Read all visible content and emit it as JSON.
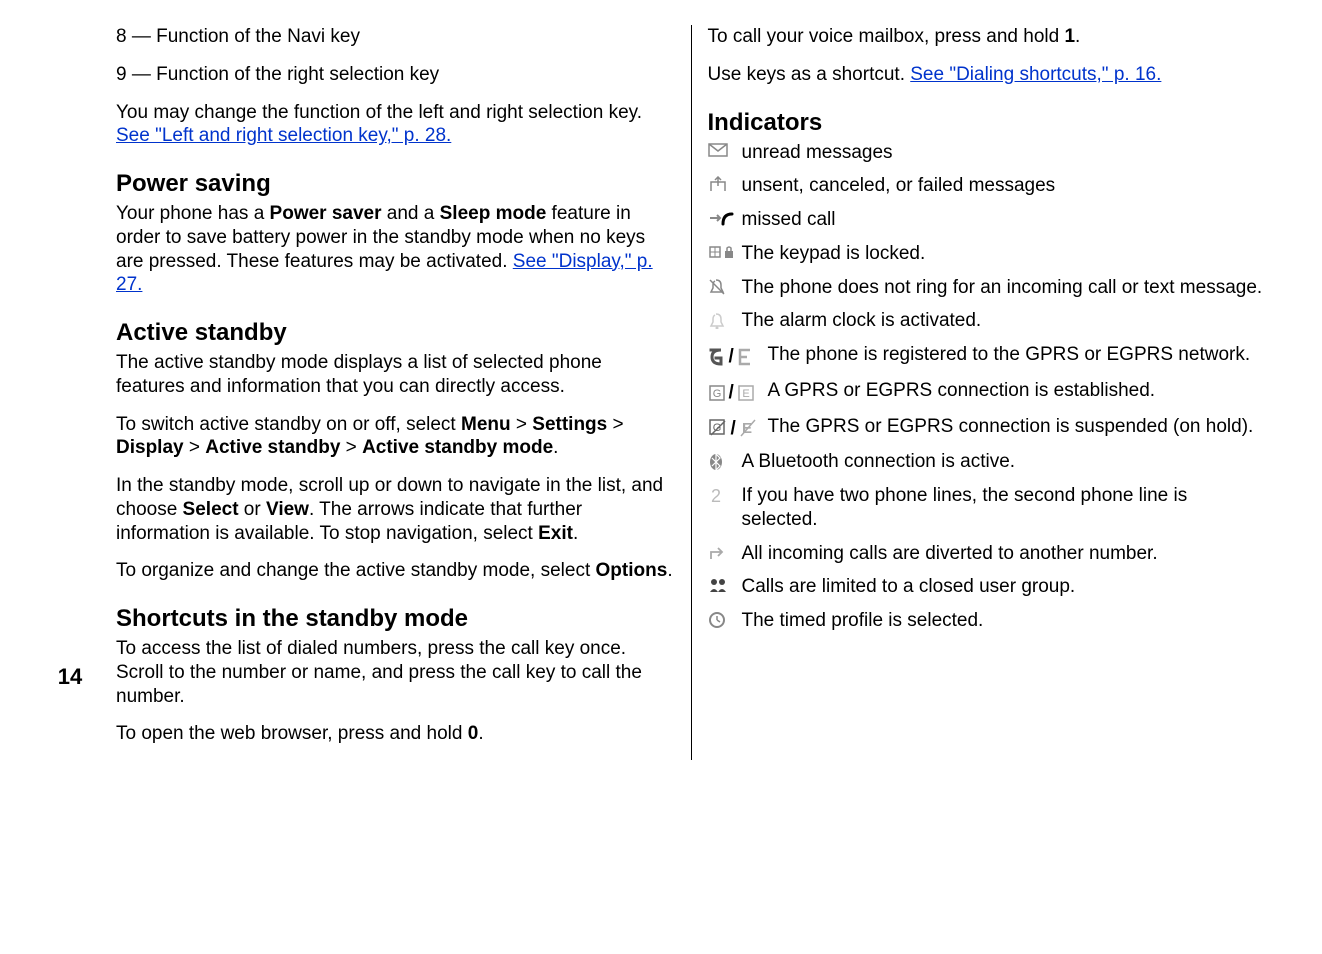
{
  "page_number": "14",
  "left": {
    "item8": "8 — Function of the Navi key",
    "item9": "9 — Function of the right selection key",
    "p1a": "You may change the function of the left and right selection key. ",
    "link1": "See \"Left and right selection key,\" p. 28.",
    "h_power": "Power saving",
    "p2a": "Your phone has a ",
    "p2b": "Power saver",
    "p2c": " and a ",
    "p2d": "Sleep mode",
    "p2e": " feature in order to save battery power in the standby mode when no keys are pressed. These features may be activated. ",
    "link2": "See \"Display,\" p. 27.",
    "h_active": "Active standby",
    "p3": "The active standby mode displays a list of selected phone features and information that you can directly access.",
    "p4a": "To switch active standby on or off, select ",
    "p4_menu": "Menu",
    "gt": " > ",
    "p4_settings": "Settings",
    "p4_display": "Display",
    "p4_as": "Active standby",
    "p4_asm": "Active standby mode",
    "period": ".",
    "p5a": "In the standby mode, scroll up or down to navigate in the list, and choose ",
    "p5_select": "Select",
    "p5b": " or ",
    "p5_view": "View",
    "p5c": ". The arrows indicate that further information is available. To stop navigation, select ",
    "p5_exit": "Exit",
    "p6a": "To organize and change the active standby mode, select ",
    "p6_opt": "Options",
    "h_short": "Shortcuts in the standby mode",
    "p7": "To access the list of dialed numbers, press the call key once. Scroll to the number or name, and press the call key to call the number.",
    "p8a": "To open the web browser, press and hold ",
    "p8_0": "0",
    "p8b": "."
  },
  "right": {
    "p1a": "To call your voice mailbox, press and hold ",
    "p1_1": "1",
    "p1b": ".",
    "p2a": "Use keys as a shortcut. ",
    "link3": "See \"Dialing shortcuts,\" p. 16.",
    "h_ind": "Indicators",
    "ind": [
      "unread messages",
      "unsent, canceled, or failed messages",
      "missed call",
      "The keypad is locked.",
      "The phone does not ring for an incoming call or text message.",
      "The alarm clock is activated.",
      "The phone is registered to the GPRS or EGPRS network.",
      "A GPRS or EGPRS connection is established.",
      "The GPRS or EGPRS connection is suspended (on hold).",
      "A Bluetooth connection is active.",
      "If you have two phone lines, the second phone line is selected.",
      "All incoming calls are diverted to another number.",
      "Calls are limited to a closed user group.",
      "The timed profile is selected."
    ],
    "slash": " / "
  }
}
